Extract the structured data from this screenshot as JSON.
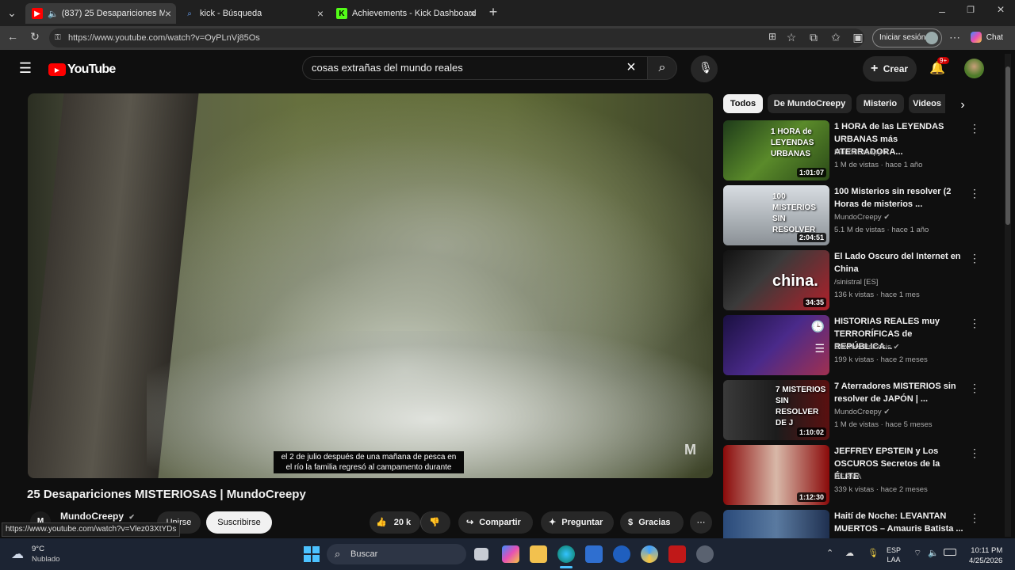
{
  "browser": {
    "tabs": [
      {
        "title": "(837) 25 Desapariciones MISTE",
        "active": true
      },
      {
        "title": "kick - Búsqueda",
        "active": false
      },
      {
        "title": "Achievements - Kick Dashboard",
        "active": false
      }
    ],
    "url": "https://www.youtube.com/watch?v=OyPLnVj85Os",
    "signin_label": "Iniciar sesión",
    "chat_label": "Chat"
  },
  "youtube": {
    "logo_text": "YouTube",
    "search_value": "cosas extrañas del mundo reales",
    "create_label": "Crear",
    "notif_badge": "9+"
  },
  "video": {
    "caption_line1": "el 2 de julio después de una mañana de pesca en",
    "caption_line2": "el río la familia regresó al campamento durante",
    "title": "25 Desapariciones MISTERIOSAS | MundoCreepy",
    "channel": "MundoCreepy",
    "join_label": "Unirse",
    "subscribe_label": "Suscribirse",
    "likes": "20 k",
    "share_label": "Compartir",
    "ask_label": "Preguntar",
    "thanks_label": "Gracias",
    "status_url": "https://www.youtube.com/watch?v=Vlez03XtYDs"
  },
  "chips": [
    "Todos",
    "De MundoCreepy",
    "Misterio",
    "Videos"
  ],
  "recommendations": [
    {
      "title": "1 HORA de las LEYENDAS URBANAS más ATERRADORA...",
      "channel": "MundoCreepy",
      "meta": "1 M de vistas · hace 1 año",
      "duration": "1:01:07",
      "thumb_text": "1 HORA de LEYENDAS URBANAS",
      "verified": true
    },
    {
      "title": "100 Misterios sin resolver (2 Horas de misterios ...",
      "channel": "MundoCreepy",
      "meta": "5.1 M de vistas · hace 1 año",
      "duration": "2:04:51",
      "thumb_text": "100 MISTERIOS SIN RESOLVER",
      "verified": true
    },
    {
      "title": "El Lado Oscuro del Internet en China",
      "channel": "/sinistral [ES]",
      "meta": "136 k vistas · hace 1 mes",
      "duration": "34:35",
      "thumb_text": "china.",
      "verified": false
    },
    {
      "title": "HISTORIAS REALES muy TERRORÍFICAS de REPÚBLICA...",
      "channel": "Blaxters Psicosis",
      "meta": "199 k vistas · hace 2 meses",
      "duration": "",
      "thumb_text": "",
      "verified": true
    },
    {
      "title": "7 Aterradores MISTERIOS sin resolver de JAPÓN | ...",
      "channel": "MundoCreepy",
      "meta": "1 M de vistas · hace 5 meses",
      "duration": "1:10:02",
      "thumb_text": "7 MISTERIOS SIN RESOLVER DE J",
      "verified": true
    },
    {
      "title": "JEFFREY EPSTEIN y Los OSCUROS Secretos de la ÉLITE",
      "channel": "DERMA",
      "meta": "339 k vistas · hace 2 meses",
      "duration": "1:12:30",
      "thumb_text": "",
      "verified": false
    },
    {
      "title": "Haití de Noche: LEVANTAN MUERTOS – Amauris Batista ...",
      "channel": "",
      "meta": "",
      "duration": "",
      "thumb_text": "",
      "verified": false
    }
  ],
  "taskbar": {
    "weather_temp": "9°C",
    "weather_desc": "Nublado",
    "search_label": "Buscar",
    "lang": "ESP",
    "lang2": "LAA",
    "time": "10:11 PM",
    "date": "4/25/2026"
  },
  "colors": {
    "yt_red": "#ff0000",
    "bg": "#0f0f0f",
    "taskbar": "#1c2433"
  }
}
